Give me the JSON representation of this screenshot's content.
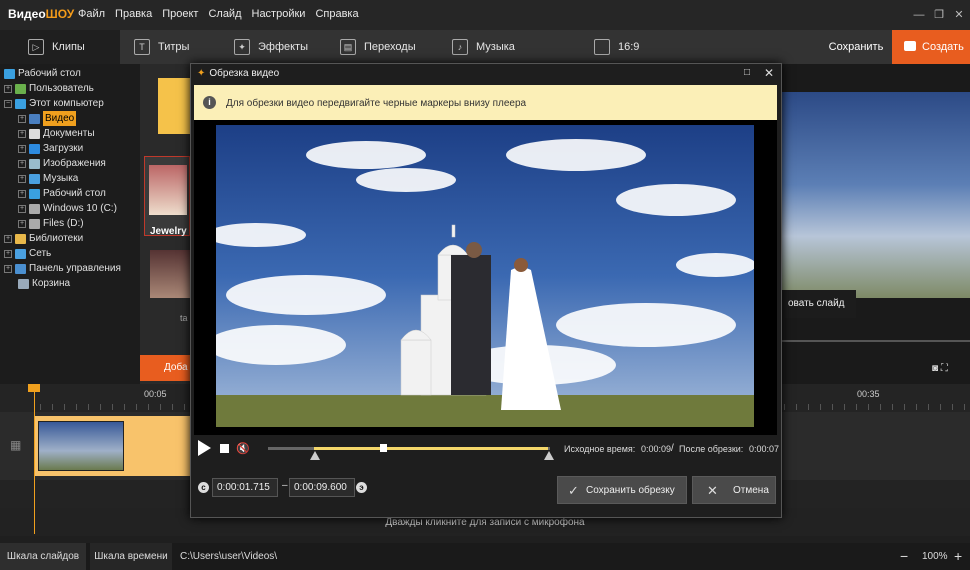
{
  "app": {
    "logo_a": "Видео",
    "logo_b": "ШОУ"
  },
  "menu": [
    "Файл",
    "Правка",
    "Проект",
    "Слайд",
    "Настройки",
    "Справка"
  ],
  "tabs": [
    {
      "label": "Клипы",
      "icon": "play-icon"
    },
    {
      "label": "Титры",
      "icon": "text-icon"
    },
    {
      "label": "Эффекты",
      "icon": "magic-wand-icon"
    },
    {
      "label": "Переходы",
      "icon": "clapper-icon"
    },
    {
      "label": "Музыка",
      "icon": "music-icon"
    }
  ],
  "aspect": "16:9",
  "save_label": "Сохранить",
  "create_label": "Создать",
  "tree": [
    {
      "label": "Рабочий стол",
      "level": 0
    },
    {
      "label": "Пользователь",
      "level": 1
    },
    {
      "label": "Этот компьютер",
      "level": 1
    },
    {
      "label": "Видео",
      "level": 2,
      "selected": true
    },
    {
      "label": "Документы",
      "level": 2
    },
    {
      "label": "Загрузки",
      "level": 2
    },
    {
      "label": "Изображения",
      "level": 2
    },
    {
      "label": "Музыка",
      "level": 2
    },
    {
      "label": "Рабочий стол",
      "level": 2
    },
    {
      "label": "Windows 10 (C:)",
      "level": 2
    },
    {
      "label": "Files (D:)",
      "level": 2
    },
    {
      "label": "Библиотеки",
      "level": 1
    },
    {
      "label": "Сеть",
      "level": 1
    },
    {
      "label": "Панель управления",
      "level": 1
    },
    {
      "label": "Корзина",
      "level": 1
    }
  ],
  "thumb_label": "Jewelry",
  "thumb2_label": "ta",
  "add_label": "Доба",
  "slide_btn": "овать слайд",
  "ruler": {
    "t1": "00:05",
    "t2": "00:35"
  },
  "mic_hint": "Дважды кликните для записи с микрофона",
  "bottom": {
    "slides": "Шкала слайдов",
    "timeline": "Шкала времени",
    "path": "C:\\Users\\user\\Videos\\",
    "zoom": "100%"
  },
  "modal": {
    "title": "Обрезка видео",
    "info": "Для обрезки видео передвигайте черные маркеры внизу плеера",
    "source_label": "Исходное время:",
    "source_value": "0:00:09",
    "after_label": "После обрезки:",
    "after_value": "0:00:07",
    "start_value": "0:00:01.715",
    "end_value": "0:00:09.600",
    "save_crop": "Сохранить обрезку",
    "cancel": "Отмена"
  }
}
